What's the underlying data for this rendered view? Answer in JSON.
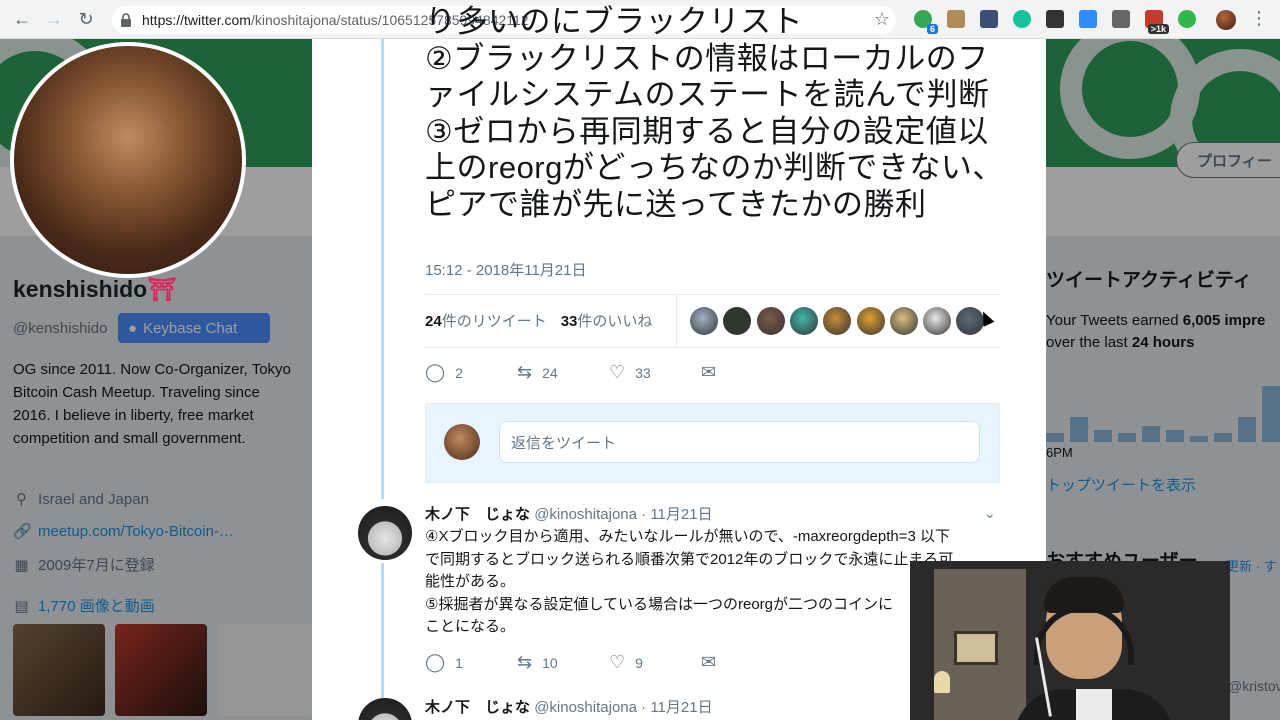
{
  "browser": {
    "url_host": "https://twitter.com",
    "url_path": "/kinoshitajona/status/1065125785994842112",
    "extensions": [
      {
        "name": "green-dot-extension",
        "color": "#34a853",
        "badge": "6"
      },
      {
        "name": "ghost-extension",
        "color": "#b08d57",
        "badge": ""
      },
      {
        "name": "lock-extension",
        "color": "#3c4f76",
        "badge": ""
      },
      {
        "name": "grammarly-extension",
        "color": "#15c39a",
        "badge": ""
      },
      {
        "name": "ninja-extension",
        "color": "#333333",
        "badge": ""
      },
      {
        "name": "camera-extension",
        "color": "#2d8cff",
        "badge": ""
      },
      {
        "name": "screen-extension",
        "color": "#666666",
        "badge": ""
      },
      {
        "name": "calendar-extension",
        "color": "#c53a2a",
        "badge": ">1k"
      },
      {
        "name": "bitcoin-extension",
        "color": "#2eb84b",
        "badge": ""
      }
    ]
  },
  "profile": {
    "display_name": "kenshishido",
    "name_emoji": "⛩",
    "handle": "@kenshishido",
    "keybase_label": "Keybase Chat",
    "bio": "OG since 2011. Now Co-Organizer, Tokyo Bitcoin Cash Meetup. Traveling since 2016. I believe in liberty, free market competition and small government.",
    "location": "Israel and Japan",
    "website": "meetup.com/Tokyo-Bitcoin-…",
    "joined": "2009年7月に登録",
    "media": "1,770 画像と動画",
    "profile_button": "プロフィー"
  },
  "sidebar": {
    "activity_title": "ツイートアクティビティ",
    "activity_line1_prefix": "Your Tweets earned ",
    "activity_line1_bold": "6,005 impre",
    "activity_line2_prefix": "over the last ",
    "activity_line2_bold": "24 hours",
    "chart_time": "6PM",
    "top_tweet_link": "トップツイートを表示",
    "suggest_title": "おすすめユーザー",
    "suggest_links": "更新 · す",
    "kristov": "@kristov"
  },
  "tweet": {
    "text_lines": [
      "り多いのにブラックリスト",
      "②ブラックリストの情報はローカルのフ",
      "ァイルシステムのステートを読んで判断",
      "③ゼロから再同期すると自分の設定値以",
      "上のreorgがどっちなのか判断できない、",
      "ピアで誰が先に送ってきたかの勝利"
    ],
    "timestamp": "15:12 - 2018年11月21日",
    "retweets_count": "24",
    "retweets_label": "件のリツイート",
    "likes_count": "33",
    "likes_label": "件のいいね",
    "reply_count": "2",
    "retweet_count": "24",
    "like_count": "33"
  },
  "reply_box": {
    "placeholder": "返信をツイート"
  },
  "replies": [
    {
      "name": "木ノ下　じょな",
      "handle": "@kinoshitajona",
      "date": "· 11月21日",
      "body_lines": [
        "④Xブロック目から適用、みたいなルールが無いので、-maxreorgdepth=3 以下",
        "で同期するとブロック送られる順番次第で2012年のブロックで永遠に止まる可",
        "能性がある。",
        "⑤採掘者が異なる設定値している場合は一つのreorgが二つのコインに",
        "ことになる。"
      ],
      "reply_count": "1",
      "retweet_count": "10",
      "like_count": "9"
    },
    {
      "name": "木ノ下　じょな",
      "handle": "@kinoshitajona",
      "date": "· 11月21日"
    }
  ],
  "likers": [
    "#9fb4c7",
    "#2b3a2a",
    "#7a5a48",
    "#3fb8a8",
    "#c88a3a",
    "#e0a030",
    "#d8c080",
    "#e8e8e8",
    "#5a6a7a"
  ],
  "chart_data": {
    "type": "bar",
    "values": [
      3,
      8,
      4,
      3,
      5,
      4,
      2,
      3,
      8,
      18,
      12
    ],
    "ylim": [
      0,
      20
    ]
  }
}
